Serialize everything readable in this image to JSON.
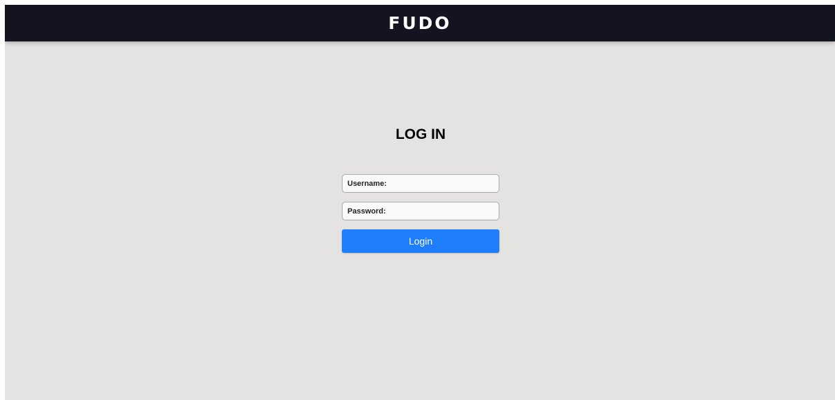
{
  "header": {
    "logo_text": "FUDO"
  },
  "login": {
    "title": "LOG IN",
    "username": {
      "placeholder": "Username:",
      "value": ""
    },
    "password": {
      "placeholder": "Password:",
      "value": ""
    },
    "submit_label": "Login"
  },
  "colors": {
    "header_bg": "#13141f",
    "page_bg": "#e4e3e1",
    "button_bg": "#1f7efb",
    "button_text": "#ffffff"
  }
}
